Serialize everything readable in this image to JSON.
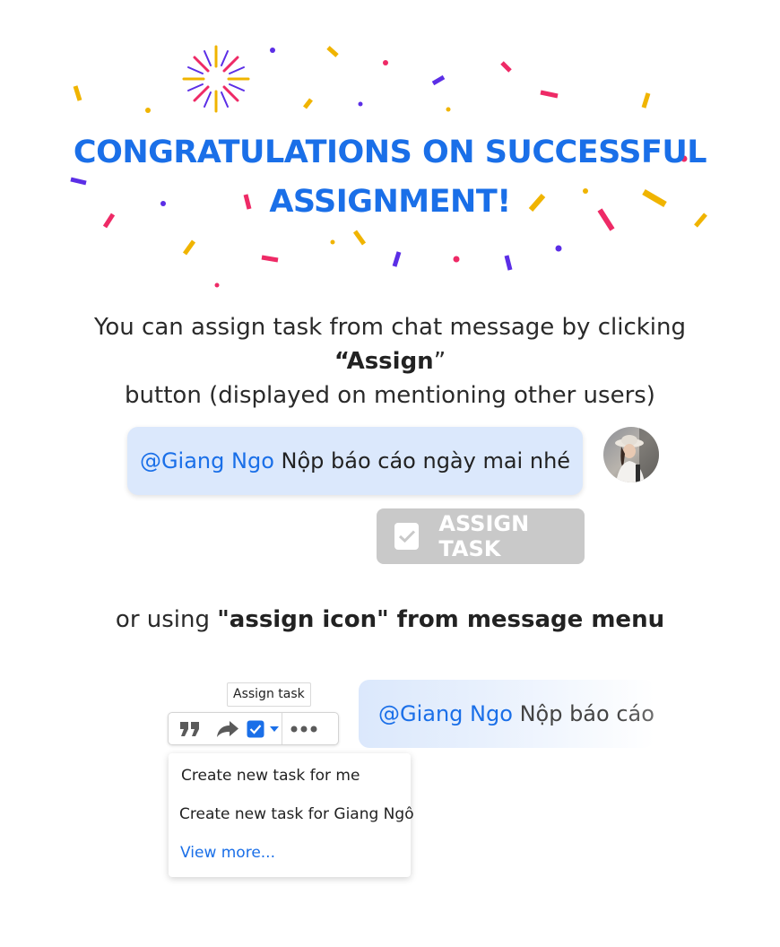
{
  "title": {
    "line1": "CONGRATULATIONS ON SUCCESSFUL",
    "line2": "ASSIGNMENT!"
  },
  "description": {
    "part1": "You can assign task from chat message by clicking ",
    "quote_open": "“",
    "assign_word": "Assign",
    "quote_close": "”",
    "part2": "button (displayed on mentioning other users)"
  },
  "chat_message": {
    "mention": "@Giang Ngo",
    "text": "Nộp báo cáo ngày mai nhé"
  },
  "assign_button": {
    "label": "ASSIGN TASK"
  },
  "alternative": {
    "prefix": "or using ",
    "emphasis": "\"assign icon\" from message menu"
  },
  "tooltip": {
    "label": "Assign task"
  },
  "toolbar": {
    "icons": [
      "quote-icon",
      "forward-icon",
      "assign-checkbox-icon",
      "dropdown-caret-icon",
      "more-icon"
    ]
  },
  "menu": {
    "items": [
      "Create new task for me",
      "Create new task for Giang Ngô",
      "View more..."
    ]
  },
  "preview_message": {
    "mention": "@Giang Ngo",
    "text": "Nộp báo cáo ngày mai nhé"
  },
  "colors": {
    "accent": "#1a6fe8",
    "bubble": "#dbe8fc",
    "button_disabled": "#c9c9c9",
    "confetti_yellow": "#f0b400",
    "confetti_pink": "#ee2a66",
    "confetti_purple": "#5b2ee6"
  }
}
